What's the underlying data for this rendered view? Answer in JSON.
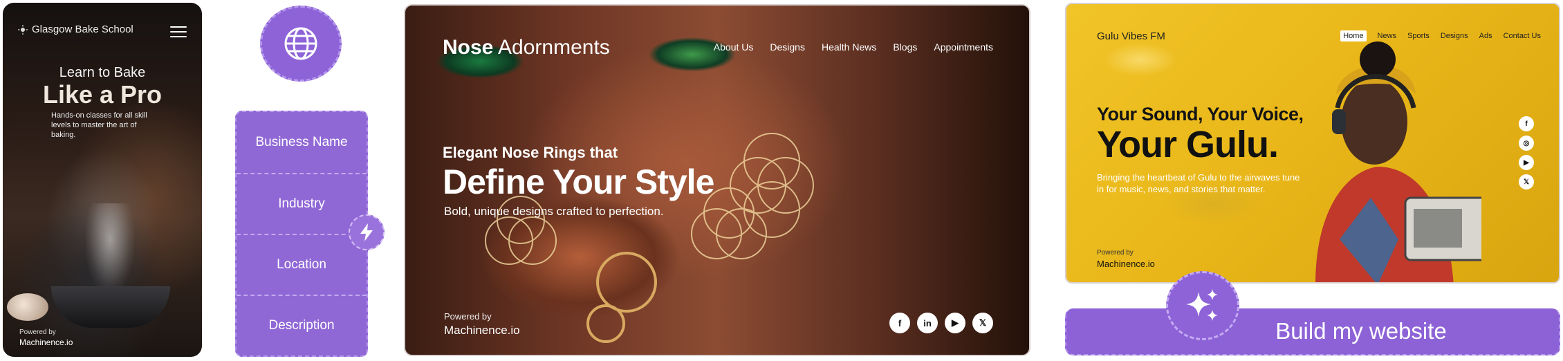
{
  "phone": {
    "brand": "Glasgow Bake School",
    "subtitle": "Learn to Bake",
    "title": "Like a Pro",
    "description": "Hands-on classes for all skill levels to master the art of baking.",
    "powered_label": "Powered by",
    "powered_brand": "Machinence.io"
  },
  "form": {
    "fields": [
      "Business Name",
      "Industry",
      "Location",
      "Description"
    ]
  },
  "nose": {
    "brand_bold": "Nose",
    "brand_rest": " Adornments",
    "nav": [
      "About Us",
      "Designs",
      "Health News",
      "Blogs",
      "Appointments"
    ],
    "kicker": "Elegant Nose Rings that",
    "headline": "Define Your Style",
    "tagline": "Bold, unique designs crafted to perfection.",
    "powered_label": "Powered by",
    "powered_brand": "Machinence.io",
    "socials": [
      "f",
      "in",
      "▶",
      "𝕏"
    ]
  },
  "gulu": {
    "brand": "Gulu Vibes FM",
    "nav": [
      "Home",
      "News",
      "Sports",
      "Designs",
      "Ads",
      "Contact Us"
    ],
    "line1": "Your Sound, Your Voice,",
    "line2": "Your Gulu.",
    "description": "Bringing the heartbeat of Gulu to the airwaves tune in for music, news, and stories that matter.",
    "powered_label": "Powered by",
    "powered_brand": "Machinence.io",
    "socials": [
      "f",
      "◎",
      "▶",
      "𝕏"
    ]
  },
  "build_button": "Build my website",
  "colors": {
    "accent": "#8e63d8",
    "accent_light": "#b597ec"
  }
}
